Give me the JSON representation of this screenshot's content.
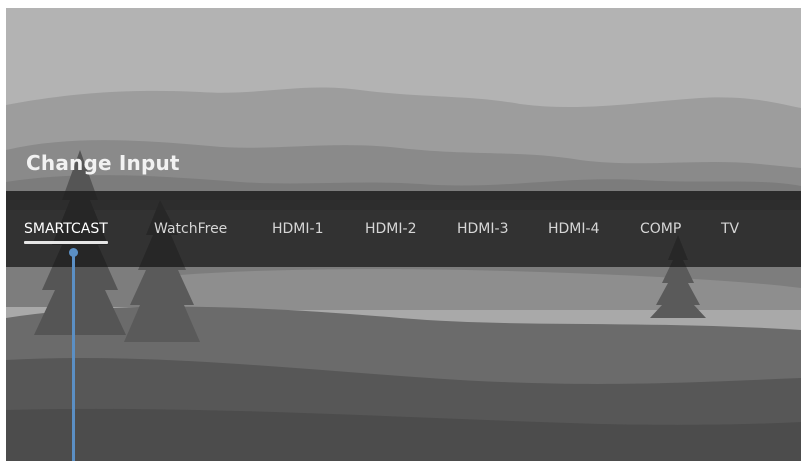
{
  "screen": {
    "title": "Change Input",
    "inputs": [
      {
        "label": "SMARTCAST",
        "selected": true
      },
      {
        "label": "WatchFree",
        "selected": false
      },
      {
        "label": "HDMI-1",
        "selected": false
      },
      {
        "label": "HDMI-2",
        "selected": false
      },
      {
        "label": "HDMI-3",
        "selected": false
      },
      {
        "label": "HDMI-4",
        "selected": false
      },
      {
        "label": "COMP",
        "selected": false
      },
      {
        "label": "TV",
        "selected": false
      }
    ]
  },
  "colors": {
    "accent_pointer": "#5b8fc4",
    "bar_background": "#1e1e1e",
    "selected_text": "#ffffff"
  }
}
